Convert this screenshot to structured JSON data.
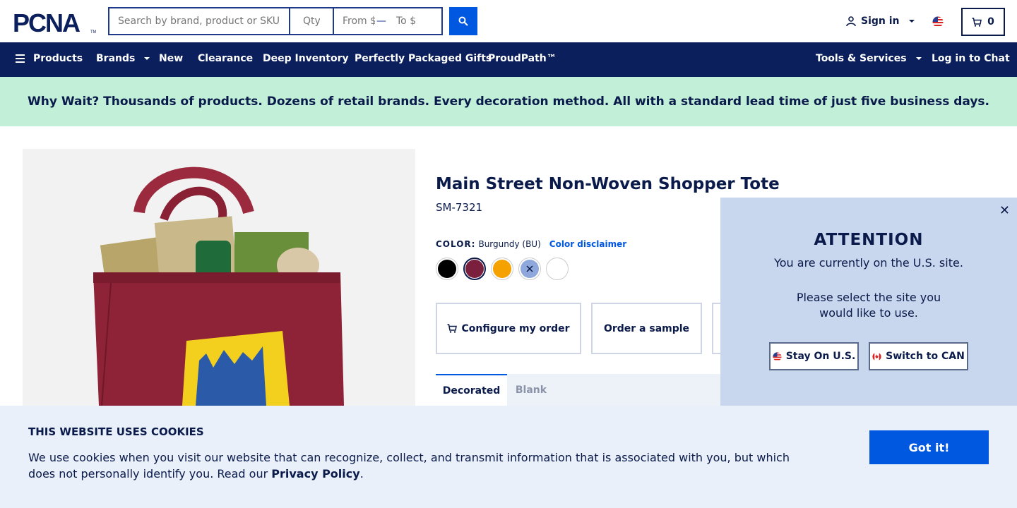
{
  "header": {
    "logo_text": "PCNA",
    "search_placeholder": "Search by brand, product or SKU",
    "qty_placeholder": "Qty",
    "price_from_placeholder": "From $",
    "price_to_placeholder": "To $",
    "signin_label": "Sign in",
    "cart_count": "0"
  },
  "nav": {
    "items": [
      "Products",
      "Brands",
      "New",
      "Clearance",
      "Deep Inventory",
      "Perfectly Packaged Gifts",
      "ProudPath™"
    ],
    "right_items": [
      "Tools & Services",
      "Log in to Chat"
    ]
  },
  "promo": {
    "text": "Why Wait? Thousands of products. Dozens of retail brands. Every decoration method. All with a standard lead time of just five business days."
  },
  "product": {
    "title": "Main Street Non-Woven Shopper Tote",
    "sku": "SM-7321",
    "color_label": "COLOR:",
    "color_value": "Burgundy (BU)",
    "color_disclaimer": "Color disclaimer",
    "swatches": [
      "#000000",
      "#7a1f3d",
      "#f5a100",
      "#8fa8dc",
      "#ffffff"
    ],
    "configure_label": "Configure my order",
    "sample_label": "Order a sample",
    "tabs": [
      "Decorated",
      "Blank"
    ]
  },
  "popup": {
    "title": "ATTENTION",
    "line1": "You are currently on the U.S. site.",
    "line2": "Please select the site you",
    "line3": "would like to use.",
    "stay_label": "Stay On U.S.",
    "switch_label": "Switch to CAN"
  },
  "cookie": {
    "title": "THIS WEBSITE USES COOKIES",
    "text_before": "We use cookies when you visit our website that can recognize, collect, and transmit information that is associated with you, but which does not personally identify you. Read our ",
    "link": "Privacy Policy",
    "text_after": ".",
    "button": "Got it!"
  }
}
